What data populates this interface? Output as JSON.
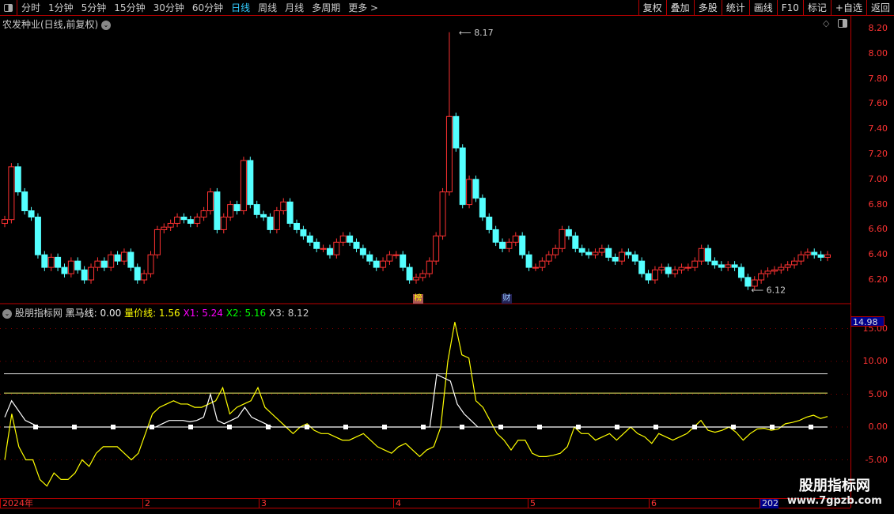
{
  "toolbar": {
    "periods": [
      "分时",
      "1分钟",
      "5分钟",
      "15分钟",
      "30分钟",
      "60分钟",
      "日线",
      "周线",
      "月线",
      "多周期",
      "更多 >"
    ],
    "active_period": "日线",
    "buttons": [
      "复权",
      "叠加",
      "多股",
      "统计",
      "画线",
      "F10",
      "标记",
      "+自选",
      "返回"
    ]
  },
  "main": {
    "title": "农发种业(日线,前复权)",
    "high_label": "8.17",
    "low_label": "6.12",
    "markers": [
      "榜",
      "财"
    ],
    "price_ticks": [
      "8.20",
      "8.00",
      "7.80",
      "7.60",
      "7.40",
      "7.20",
      "7.00",
      "6.80",
      "6.60",
      "6.40",
      "6.20"
    ]
  },
  "indicator": {
    "name": "股朋指标网",
    "l1": "黑马线: 0.00",
    "l2": "量价线: 1.56",
    "l3": "X1: 5.24",
    "l4": "X2: 5.16",
    "l5": "X3: 8.12",
    "current": "14.98",
    "ticks": [
      "15.00",
      "10.00",
      "5.00",
      "0.00",
      "-5.00"
    ]
  },
  "dates": [
    "2024年",
    "2",
    "3",
    "4",
    "5",
    "6",
    "202"
  ],
  "watermark": {
    "name": "股朋指标网",
    "url": "www.7gpzb.com"
  },
  "colors": {
    "up": "#ff3232",
    "down": "#54ffff",
    "yellow": "#ffff00",
    "axis": "#b00000"
  },
  "chart_data": {
    "type": "candlestick",
    "closes": [
      6.68,
      7.1,
      6.9,
      6.75,
      6.7,
      6.4,
      6.3,
      6.38,
      6.3,
      6.25,
      6.35,
      6.28,
      6.2,
      6.3,
      6.35,
      6.3,
      6.4,
      6.35,
      6.42,
      6.3,
      6.2,
      6.25,
      6.4,
      6.6,
      6.62,
      6.65,
      6.7,
      6.68,
      6.65,
      6.7,
      6.75,
      6.9,
      6.6,
      6.7,
      6.8,
      6.75,
      7.15,
      6.8,
      6.72,
      6.7,
      6.6,
      6.75,
      6.82,
      6.65,
      6.6,
      6.55,
      6.5,
      6.45,
      6.45,
      6.4,
      6.5,
      6.55,
      6.5,
      6.45,
      6.4,
      6.35,
      6.3,
      6.35,
      6.4,
      6.4,
      6.3,
      6.2,
      6.22,
      6.25,
      6.35,
      6.55,
      6.9,
      7.5,
      7.25,
      6.8,
      7.0,
      6.85,
      6.7,
      6.6,
      6.5,
      6.45,
      6.5,
      6.55,
      6.4,
      6.3,
      6.3,
      6.35,
      6.4,
      6.45,
      6.6,
      6.55,
      6.45,
      6.42,
      6.4,
      6.42,
      6.45,
      6.38,
      6.35,
      6.42,
      6.4,
      6.35,
      6.25,
      6.2,
      6.28,
      6.3,
      6.25,
      6.28,
      6.3,
      6.3,
      6.35,
      6.45,
      6.35,
      6.32,
      6.3,
      6.32,
      6.3,
      6.22,
      6.15,
      6.2,
      6.25,
      6.27,
      6.28,
      6.3,
      6.32,
      6.35,
      6.4,
      6.42,
      6.4,
      6.38,
      6.4
    ],
    "yellow": [
      -5,
      2,
      -3,
      -5,
      -5,
      -8,
      -9,
      -7,
      -8,
      -8,
      -7,
      -5,
      -6,
      -4,
      -3,
      -3,
      -3,
      -4,
      -5,
      -4,
      -1,
      2,
      3,
      3.5,
      4,
      3.5,
      3.5,
      3,
      3,
      3.5,
      4,
      6,
      2,
      3,
      3.5,
      4,
      6,
      3,
      2,
      1,
      0,
      -1,
      0,
      0.5,
      -0.5,
      -1,
      -1,
      -1.5,
      -2,
      -2,
      -1.5,
      -1,
      -2,
      -3,
      -3.5,
      -4,
      -3,
      -2.5,
      -3.5,
      -4.5,
      -3.5,
      -3,
      0,
      10,
      16,
      11,
      10.5,
      4,
      3,
      1,
      -1,
      -2,
      -3.5,
      -2,
      -2,
      -4,
      -4.5,
      -4.5,
      -4.3,
      -4,
      -3,
      0,
      -1,
      -1,
      -2,
      -1.5,
      -1,
      -2,
      -1,
      0,
      -1,
      -1.5,
      -2.5,
      -1,
      -1.5,
      -2,
      -1.5,
      -1,
      0,
      1,
      -0.5,
      -0.8,
      -0.5,
      0,
      -0.8,
      -2,
      -1,
      -0.3,
      -0.2,
      -0.5,
      -0.3,
      0.5,
      0.7,
      1,
      1.5,
      1.8,
      1.3,
      1.6
    ],
    "white": [
      1.5,
      4,
      2.5,
      1,
      0.5,
      0,
      0,
      0,
      0,
      0,
      0,
      0,
      0,
      0,
      0,
      0,
      0,
      0,
      0,
      0,
      0,
      0,
      0,
      0.5,
      1,
      1,
      1,
      0.8,
      1,
      1.5,
      5,
      1,
      0.5,
      1,
      1.5,
      3,
      1.5,
      1,
      0.5,
      0,
      0,
      0,
      0,
      0,
      0,
      0,
      0,
      0,
      0,
      0,
      0,
      0,
      0,
      0,
      0,
      0,
      0,
      0,
      0,
      0,
      0,
      0,
      0,
      8,
      7.5,
      7,
      3.5,
      2,
      1,
      0,
      0,
      0,
      0,
      0,
      0,
      0,
      0,
      0,
      0,
      0,
      0,
      0,
      0,
      0,
      0,
      0,
      0,
      0,
      0,
      0,
      0,
      0,
      0,
      0,
      0,
      0,
      0,
      0,
      0,
      0,
      0,
      0,
      0,
      0,
      0,
      0,
      0,
      0,
      0,
      0,
      0,
      0,
      0,
      0,
      0,
      0,
      0,
      0,
      0,
      0,
      0
    ],
    "lines": {
      "X3": 8.12,
      "X2": 5.16
    },
    "price_range": [
      6.1,
      8.25
    ],
    "ind_range": [
      -7,
      17
    ]
  }
}
